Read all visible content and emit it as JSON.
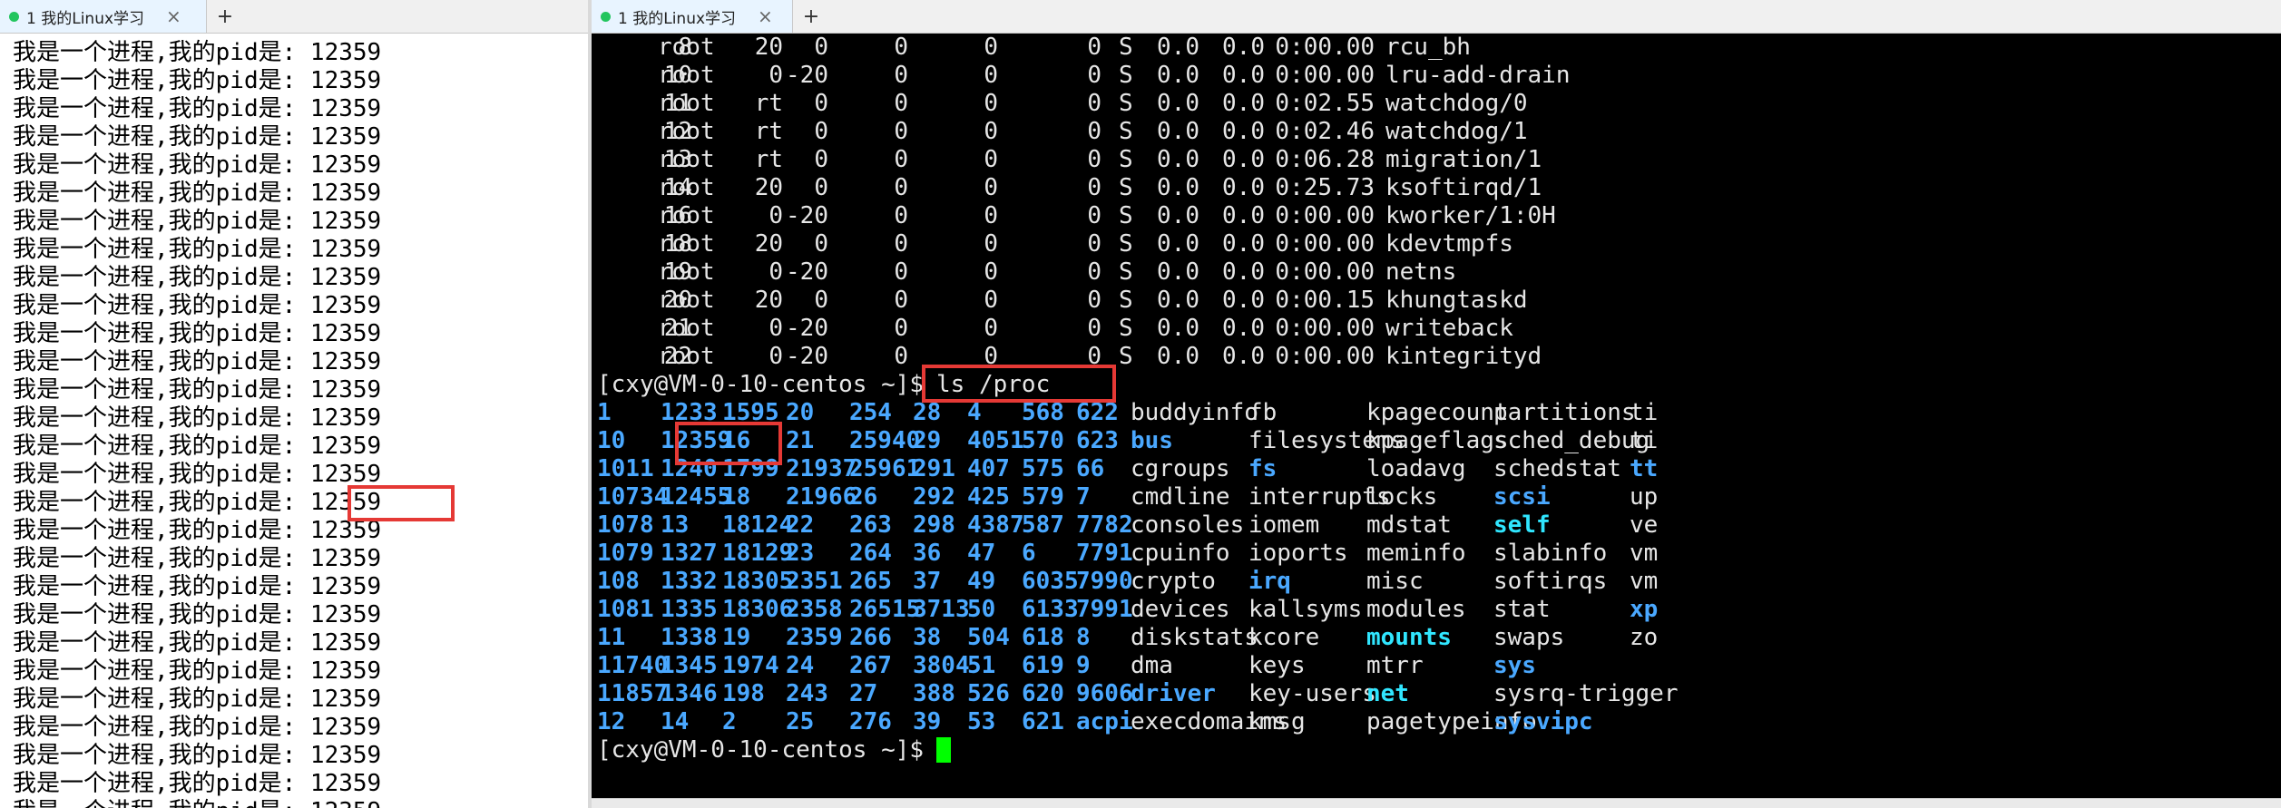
{
  "left": {
    "tab_title": "1 我的Linux学习",
    "close_glyph": "×",
    "add_glyph": "+",
    "lines": [
      "我是一个进程,我的pid是: 12359",
      "我是一个进程,我的pid是: 12359",
      "我是一个进程,我的pid是: 12359",
      "我是一个进程,我的pid是: 12359",
      "我是一个进程,我的pid是: 12359",
      "我是一个进程,我的pid是: 12359",
      "我是一个进程,我的pid是: 12359",
      "我是一个进程,我的pid是: 12359",
      "我是一个进程,我的pid是: 12359",
      "我是一个进程,我的pid是: 12359",
      "我是一个进程,我的pid是: 12359",
      "我是一个进程,我的pid是: 12359",
      "我是一个进程,我的pid是: 12359",
      "我是一个进程,我的pid是: 12359",
      "我是一个进程,我的pid是: 12359",
      "我是一个进程,我的pid是: 12359",
      "我是一个进程,我的pid是: 12359",
      "我是一个进程,我的pid是: 12359",
      "我是一个进程,我的pid是: 12359",
      "我是一个进程,我的pid是: 12359",
      "我是一个进程,我的pid是: 12359",
      "我是一个进程,我的pid是: 12359",
      "我是一个进程,我的pid是: 12359",
      "我是一个进程,我的pid是: 12359",
      "我是一个进程,我的pid是: 12359",
      "我是一个进程,我的pid是: 12359",
      "我是一个进程,我的pid是: 12359",
      "我是一个进程,我的pid是: 12359"
    ]
  },
  "right": {
    "tab_title": "1 我的Linux学习",
    "close_glyph": "×",
    "add_glyph": "+",
    "top_rows": [
      [
        "8",
        "root",
        "20",
        "0",
        "0",
        "0",
        "0",
        "S",
        "0.0",
        "0.0",
        "0:00.00",
        "rcu_bh"
      ],
      [
        "10",
        "root",
        "0",
        "-20",
        "0",
        "0",
        "0",
        "S",
        "0.0",
        "0.0",
        "0:00.00",
        "lru-add-drain"
      ],
      [
        "11",
        "root",
        "rt",
        "0",
        "0",
        "0",
        "0",
        "S",
        "0.0",
        "0.0",
        "0:02.55",
        "watchdog/0"
      ],
      [
        "12",
        "root",
        "rt",
        "0",
        "0",
        "0",
        "0",
        "S",
        "0.0",
        "0.0",
        "0:02.46",
        "watchdog/1"
      ],
      [
        "13",
        "root",
        "rt",
        "0",
        "0",
        "0",
        "0",
        "S",
        "0.0",
        "0.0",
        "0:06.28",
        "migration/1"
      ],
      [
        "14",
        "root",
        "20",
        "0",
        "0",
        "0",
        "0",
        "S",
        "0.0",
        "0.0",
        "0:25.73",
        "ksoftirqd/1"
      ],
      [
        "16",
        "root",
        "0",
        "-20",
        "0",
        "0",
        "0",
        "S",
        "0.0",
        "0.0",
        "0:00.00",
        "kworker/1:0H"
      ],
      [
        "18",
        "root",
        "20",
        "0",
        "0",
        "0",
        "0",
        "S",
        "0.0",
        "0.0",
        "0:00.00",
        "kdevtmpfs"
      ],
      [
        "19",
        "root",
        "0",
        "-20",
        "0",
        "0",
        "0",
        "S",
        "0.0",
        "0.0",
        "0:00.00",
        "netns"
      ],
      [
        "20",
        "root",
        "20",
        "0",
        "0",
        "0",
        "0",
        "S",
        "0.0",
        "0.0",
        "0:00.15",
        "khungtaskd"
      ],
      [
        "21",
        "root",
        "0",
        "-20",
        "0",
        "0",
        "0",
        "S",
        "0.0",
        "0.0",
        "0:00.00",
        "writeback"
      ],
      [
        "22",
        "root",
        "0",
        "-20",
        "0",
        "0",
        "0",
        "S",
        "0.0",
        "0.0",
        "0:00.00",
        "kintegrityd"
      ]
    ],
    "prompt": "[cxy@VM-0-10-centos ~]$ ",
    "command": "ls /proc",
    "ls_rows": [
      [
        [
          "1",
          "b"
        ],
        [
          "1233",
          "b"
        ],
        [
          "1595",
          "b"
        ],
        [
          "20",
          "b"
        ],
        [
          "254",
          "b"
        ],
        [
          "28",
          "b"
        ],
        [
          "4",
          "b"
        ],
        [
          "568",
          "b"
        ],
        [
          "622",
          "b"
        ],
        [
          "buddyinfo",
          "w"
        ],
        [
          "fb",
          "w"
        ],
        [
          "kpagecount",
          "w"
        ],
        [
          "partitions",
          "w"
        ],
        [
          "ti",
          "w"
        ]
      ],
      [
        [
          "10",
          "b"
        ],
        [
          "12359",
          "b"
        ],
        [
          "16",
          "b"
        ],
        [
          "21",
          "b"
        ],
        [
          "25940",
          "b"
        ],
        [
          "29",
          "b"
        ],
        [
          "4051",
          "b"
        ],
        [
          "570",
          "b"
        ],
        [
          "623",
          "b"
        ],
        [
          "bus",
          "b"
        ],
        [
          "filesystems",
          "w"
        ],
        [
          "kpageflags",
          "w"
        ],
        [
          "sched_debug",
          "w"
        ],
        [
          "ti",
          "w"
        ]
      ],
      [
        [
          "1011",
          "b"
        ],
        [
          "1240",
          "b"
        ],
        [
          "1799",
          "b"
        ],
        [
          "21937",
          "b"
        ],
        [
          "25961",
          "b"
        ],
        [
          "291",
          "b"
        ],
        [
          "407",
          "b"
        ],
        [
          "575",
          "b"
        ],
        [
          "66",
          "b"
        ],
        [
          "cgroups",
          "w"
        ],
        [
          "fs",
          "b"
        ],
        [
          "loadavg",
          "w"
        ],
        [
          "schedstat",
          "w"
        ],
        [
          "tt",
          "b"
        ]
      ],
      [
        [
          "10734",
          "b"
        ],
        [
          "12455",
          "b"
        ],
        [
          "18",
          "b"
        ],
        [
          "21966",
          "b"
        ],
        [
          "26",
          "b"
        ],
        [
          "292",
          "b"
        ],
        [
          "425",
          "b"
        ],
        [
          "579",
          "b"
        ],
        [
          "7",
          "b"
        ],
        [
          "cmdline",
          "w"
        ],
        [
          "interrupts",
          "w"
        ],
        [
          "locks",
          "w"
        ],
        [
          "scsi",
          "b"
        ],
        [
          "up",
          "w"
        ]
      ],
      [
        [
          "1078",
          "b"
        ],
        [
          "13",
          "b"
        ],
        [
          "18124",
          "b"
        ],
        [
          "22",
          "b"
        ],
        [
          "263",
          "b"
        ],
        [
          "298",
          "b"
        ],
        [
          "4387",
          "b"
        ],
        [
          "587",
          "b"
        ],
        [
          "7782",
          "b"
        ],
        [
          "consoles",
          "w"
        ],
        [
          "iomem",
          "w"
        ],
        [
          "mdstat",
          "w"
        ],
        [
          "self",
          "c"
        ],
        [
          "ve",
          "w"
        ]
      ],
      [
        [
          "1079",
          "b"
        ],
        [
          "1327",
          "b"
        ],
        [
          "18129",
          "b"
        ],
        [
          "23",
          "b"
        ],
        [
          "264",
          "b"
        ],
        [
          "36",
          "b"
        ],
        [
          "47",
          "b"
        ],
        [
          "6",
          "b"
        ],
        [
          "7791",
          "b"
        ],
        [
          "cpuinfo",
          "w"
        ],
        [
          "ioports",
          "w"
        ],
        [
          "meminfo",
          "w"
        ],
        [
          "slabinfo",
          "w"
        ],
        [
          "vm",
          "w"
        ]
      ],
      [
        [
          "108",
          "b"
        ],
        [
          "1332",
          "b"
        ],
        [
          "18305",
          "b"
        ],
        [
          "2351",
          "b"
        ],
        [
          "265",
          "b"
        ],
        [
          "37",
          "b"
        ],
        [
          "49",
          "b"
        ],
        [
          "6035",
          "b"
        ],
        [
          "7990",
          "b"
        ],
        [
          "crypto",
          "w"
        ],
        [
          "irq",
          "b"
        ],
        [
          "misc",
          "w"
        ],
        [
          "softirqs",
          "w"
        ],
        [
          "vm",
          "w"
        ]
      ],
      [
        [
          "1081",
          "b"
        ],
        [
          "1335",
          "b"
        ],
        [
          "18306",
          "b"
        ],
        [
          "2358",
          "b"
        ],
        [
          "26515",
          "b"
        ],
        [
          "3713",
          "b"
        ],
        [
          "50",
          "b"
        ],
        [
          "6133",
          "b"
        ],
        [
          "7991",
          "b"
        ],
        [
          "devices",
          "w"
        ],
        [
          "kallsyms",
          "w"
        ],
        [
          "modules",
          "w"
        ],
        [
          "stat",
          "w"
        ],
        [
          "xp",
          "b"
        ]
      ],
      [
        [
          "11",
          "b"
        ],
        [
          "1338",
          "b"
        ],
        [
          "19",
          "b"
        ],
        [
          "2359",
          "b"
        ],
        [
          "266",
          "b"
        ],
        [
          "38",
          "b"
        ],
        [
          "504",
          "b"
        ],
        [
          "618",
          "b"
        ],
        [
          "8",
          "b"
        ],
        [
          "diskstats",
          "w"
        ],
        [
          "kcore",
          "w"
        ],
        [
          "mounts",
          "c"
        ],
        [
          "swaps",
          "w"
        ],
        [
          "zo",
          "w"
        ]
      ],
      [
        [
          "11740",
          "b"
        ],
        [
          "1345",
          "b"
        ],
        [
          "1974",
          "b"
        ],
        [
          "24",
          "b"
        ],
        [
          "267",
          "b"
        ],
        [
          "3804",
          "b"
        ],
        [
          "51",
          "b"
        ],
        [
          "619",
          "b"
        ],
        [
          "9",
          "b"
        ],
        [
          "dma",
          "w"
        ],
        [
          "keys",
          "w"
        ],
        [
          "mtrr",
          "w"
        ],
        [
          "sys",
          "b"
        ],
        [
          "",
          "w"
        ]
      ],
      [
        [
          "11857",
          "b"
        ],
        [
          "1346",
          "b"
        ],
        [
          "198",
          "b"
        ],
        [
          "243",
          "b"
        ],
        [
          "27",
          "b"
        ],
        [
          "388",
          "b"
        ],
        [
          "526",
          "b"
        ],
        [
          "620",
          "b"
        ],
        [
          "9606",
          "b"
        ],
        [
          "driver",
          "b"
        ],
        [
          "key-users",
          "w"
        ],
        [
          "net",
          "c"
        ],
        [
          "sysrq-trigger",
          "w"
        ],
        [
          "",
          "w"
        ]
      ],
      [
        [
          "12",
          "b"
        ],
        [
          "14",
          "b"
        ],
        [
          "2",
          "b"
        ],
        [
          "25",
          "b"
        ],
        [
          "276",
          "b"
        ],
        [
          "39",
          "b"
        ],
        [
          "53",
          "b"
        ],
        [
          "621",
          "b"
        ],
        [
          "acpi",
          "b"
        ],
        [
          "execdomains",
          "w"
        ],
        [
          "kmsg",
          "w"
        ],
        [
          "pagetypeinfo",
          "w"
        ],
        [
          "sysvipc",
          "b"
        ],
        [
          "",
          "w"
        ]
      ]
    ],
    "final_prompt": "[cxy@VM-0-10-centos ~]$ "
  }
}
